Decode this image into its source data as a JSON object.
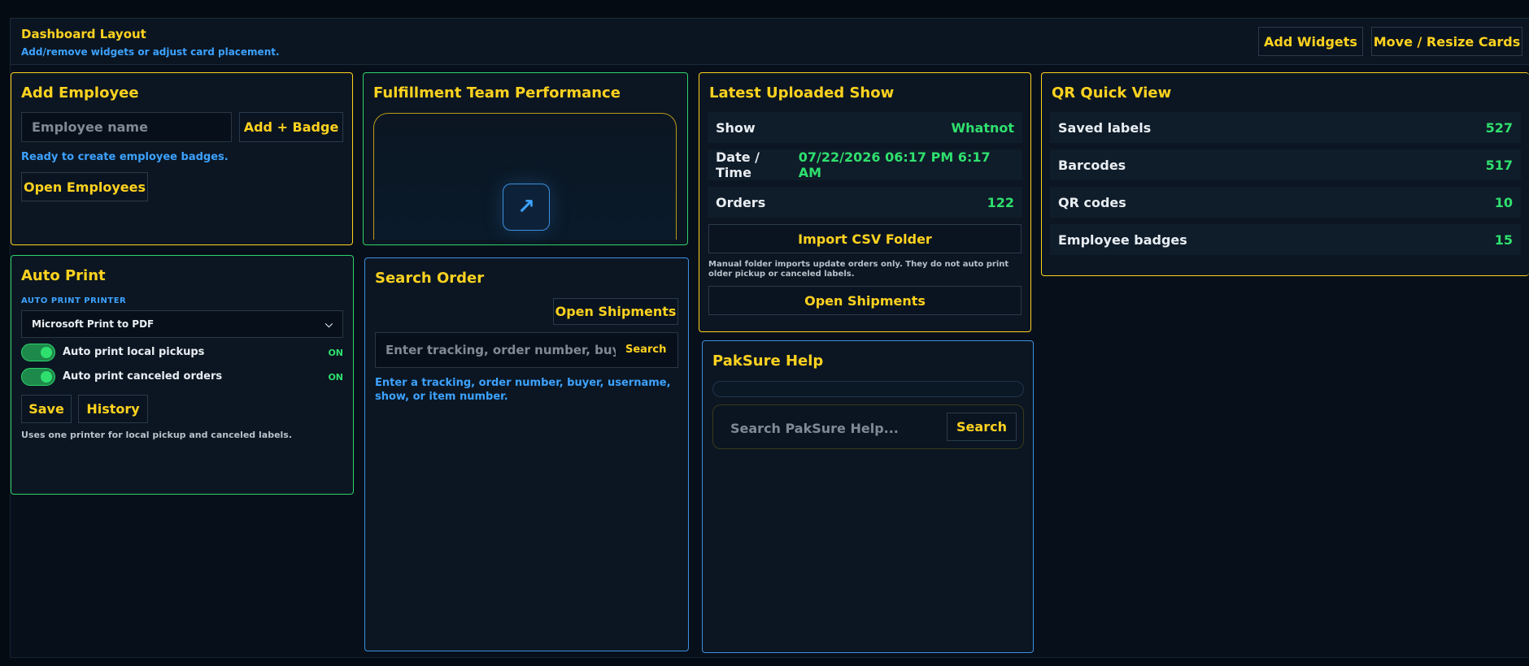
{
  "layout_bar": {
    "title": "Dashboard Layout",
    "subtitle": "Add/remove widgets or adjust card placement.",
    "add_widgets": "Add Widgets",
    "move_resize": "Move / Resize Cards"
  },
  "add_employee": {
    "title": "Add Employee",
    "name_placeholder": "Employee name",
    "add_badge": "Add + Badge",
    "status": "Ready to create employee badges.",
    "open_employees": "Open Employees"
  },
  "fulfillment": {
    "title": "Fulfillment Team Performance",
    "expand_icon": "arrow-up-right-icon",
    "expand_glyph": "↗"
  },
  "latest_show": {
    "title": "Latest Uploaded Show",
    "rows": [
      {
        "label": "Show",
        "value": "Whatnot"
      },
      {
        "label": "Date / Time",
        "value": "07/22/2026 06:17 PM 6:17 AM"
      },
      {
        "label": "Orders",
        "value": "122"
      }
    ],
    "import_csv": "Import CSV Folder",
    "note": "Manual folder imports update orders only. They do not auto print older pickup or canceled labels.",
    "open_shipments": "Open Shipments"
  },
  "qr_quick_view": {
    "title": "QR Quick View",
    "rows": [
      {
        "label": "Saved labels",
        "value": "527"
      },
      {
        "label": "Barcodes",
        "value": "517"
      },
      {
        "label": "QR codes",
        "value": "10"
      },
      {
        "label": "Employee badges",
        "value": "15"
      }
    ]
  },
  "auto_print": {
    "title": "Auto Print",
    "printer_label": "AUTO PRINT PRINTER",
    "printer_selected": "Microsoft Print to PDF",
    "toggles": [
      {
        "label": "Auto print local pickups",
        "state": "ON"
      },
      {
        "label": "Auto print canceled orders",
        "state": "ON"
      }
    ],
    "save": "Save",
    "history": "History",
    "note": "Uses one printer for local pickup and canceled labels."
  },
  "search_order": {
    "title": "Search Order",
    "open_shipments": "Open Shipments",
    "placeholder": "Enter tracking, order number, buyer, u",
    "search": "Search",
    "hint": "Enter a tracking, order number, buyer, username, show, or item number."
  },
  "paksure_help": {
    "title": "PakSure Help",
    "placeholder": "Search PakSure Help...",
    "search": "Search"
  },
  "colors": {
    "accent": "#ffd21f",
    "success": "#2fe06e",
    "info": "#3da2ff",
    "background": "#050b12"
  }
}
